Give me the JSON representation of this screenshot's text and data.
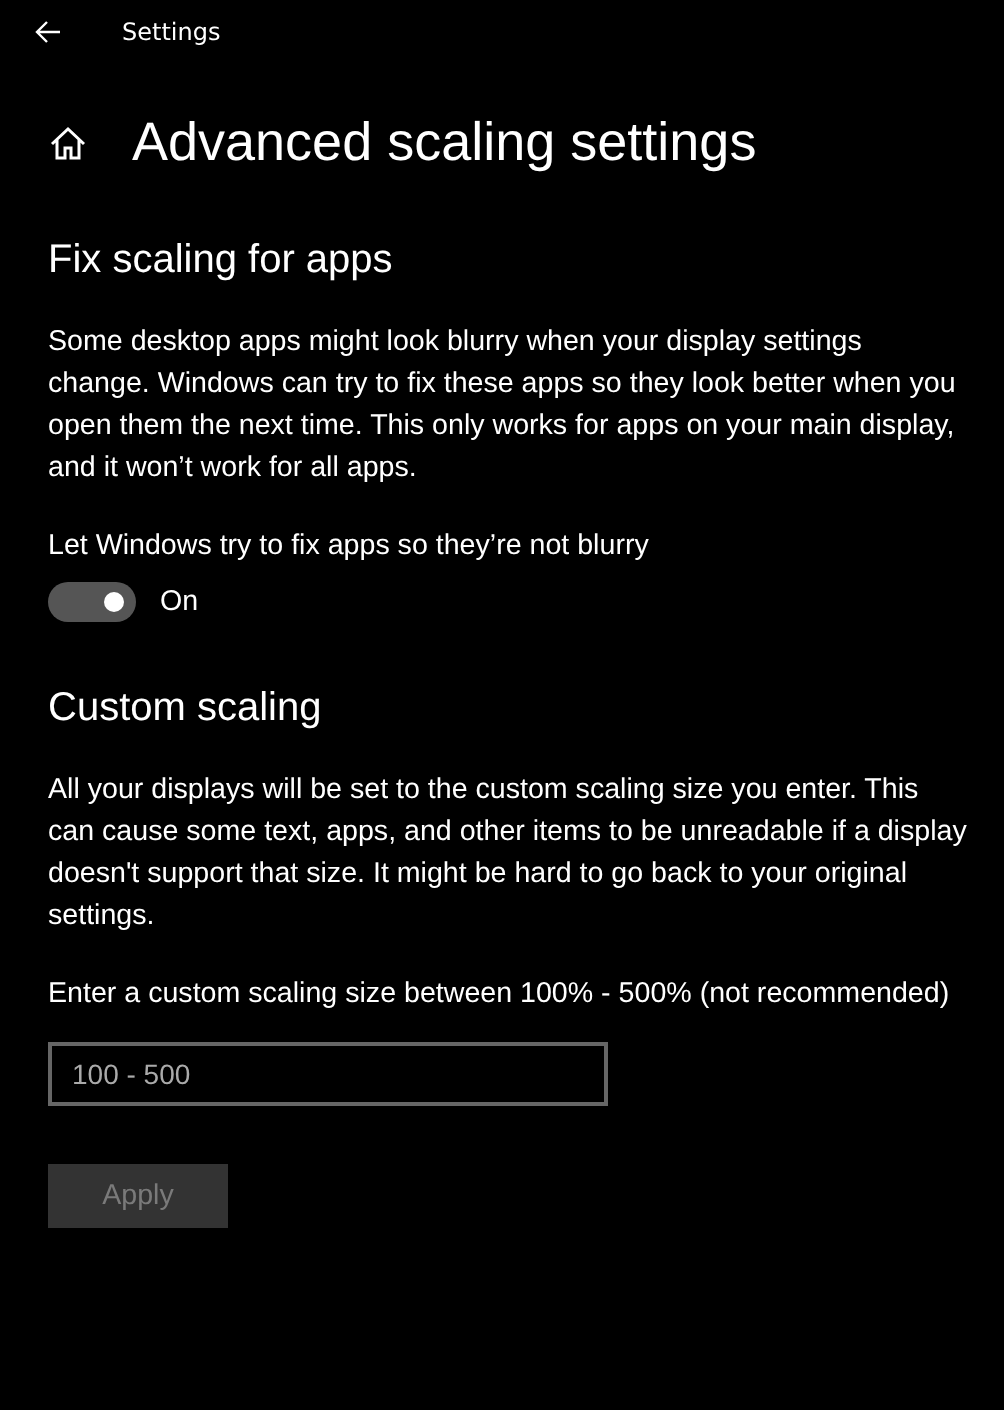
{
  "window": {
    "title": "Settings"
  },
  "page_title": "Advanced scaling settings",
  "sections": [
    {
      "kind": "toggle",
      "heading": "Fix scaling for apps",
      "description": "Some desktop apps might look blurry when your display settings change. Windows can try to fix these apps so they look better when you open them the next time. This only works for apps on your main display, and it won’t work for all apps.",
      "label": "Let Windows try to fix apps so they’re not blurry",
      "on": true,
      "state_text": "On"
    },
    {
      "kind": "input",
      "heading": "Custom scaling",
      "description": "All your displays will be set to the custom scaling size you enter. This can cause some text, apps, and other items to be unreadable if a display doesn't support that size. It might be hard to go back to your original settings.",
      "label": "Enter a custom scaling size between 100% - 500% (not recommended)",
      "placeholder": "100 - 500",
      "button": {
        "label": "Apply",
        "disabled": true
      }
    }
  ]
}
